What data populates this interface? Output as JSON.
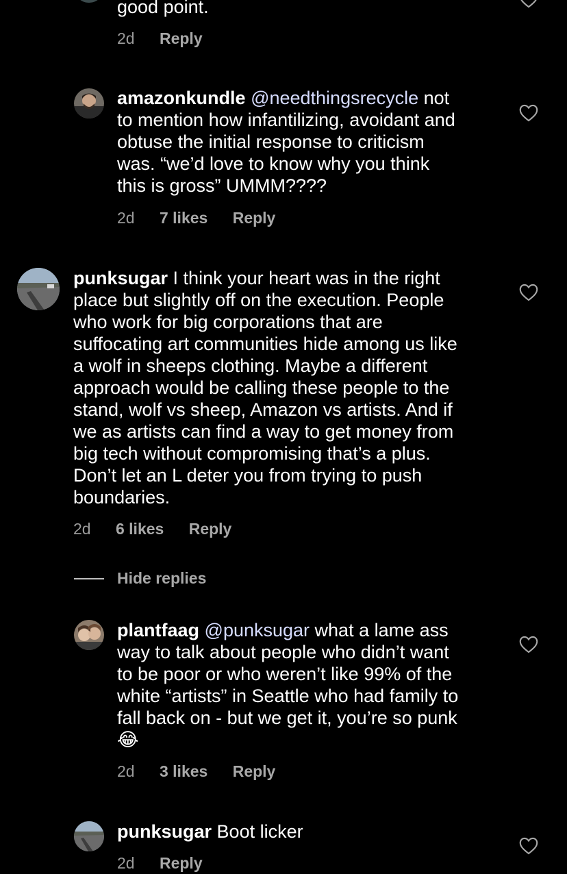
{
  "comments": [
    {
      "username": "",
      "text": "good point.",
      "time": "2d",
      "likes": "",
      "reply_label": "Reply"
    },
    {
      "username": "amazonkundle",
      "mention": "@needthingsrecycle",
      "line1_rest": "not",
      "lines": [
        "to mention how infantilizing, avoidant and",
        "obtuse the initial response to criticism",
        "was. “we’d love to know why you think",
        "this is gross” UMMM????"
      ],
      "time": "2d",
      "likes": "7 likes",
      "reply_label": "Reply"
    },
    {
      "username": "punksugar",
      "line1_rest": "I think your heart was in the right",
      "lines": [
        "place but slightly off on the execution. People",
        "who work for big corporations that are",
        "suffocating art communities hide among us like",
        "a wolf in sheeps clothing. Maybe a different",
        "approach would be calling these people to the",
        "stand, wolf vs sheep, Amazon vs artists. And if",
        "we as artists can find a way to get money from",
        "big tech without compromising that’s a plus.",
        "Don’t let an L deter you from trying to push",
        "boundaries."
      ],
      "time": "2d",
      "likes": "6 likes",
      "reply_label": "Reply"
    },
    {
      "username": "plantfaag",
      "mention": "@punksugar",
      "line1_rest": "what a lame ass",
      "lines": [
        "way to talk about people who didn’t want",
        "to be poor or who weren’t like 99% of the",
        "white “artists” in Seattle who had family to",
        "fall back on - but we get it, you’re so punk",
        "😂"
      ],
      "time": "2d",
      "likes": "3 likes",
      "reply_label": "Reply"
    },
    {
      "username": "punksugar",
      "line1_rest": "Boot licker",
      "time": "2d",
      "likes": "",
      "reply_label": "Reply"
    }
  ],
  "hide_replies_label": "Hide replies",
  "icons": {
    "like": "heart-outline-icon"
  },
  "colors": {
    "background": "#000000",
    "text": "#ffffff",
    "meta": "#9a9a9a",
    "mention": "#d6dcff"
  }
}
